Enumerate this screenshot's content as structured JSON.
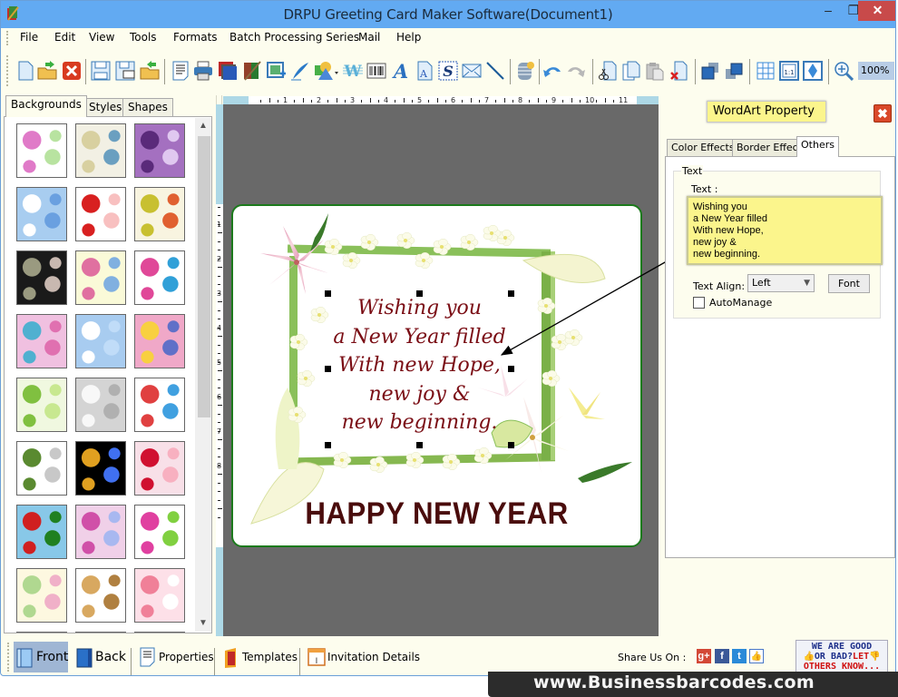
{
  "window": {
    "title": "DRPU Greeting Card Maker Software(Document1)",
    "minimize": "–",
    "maximize": "❐",
    "close": "✕"
  },
  "menu": [
    "File",
    "Edit",
    "View",
    "Tools",
    "Formats",
    "Batch Processing Series",
    "Mail",
    "Help"
  ],
  "toolbar": {
    "buttons": [
      "new",
      "open",
      "close-document",
      "save",
      "save-as",
      "export",
      "page-properties",
      "print",
      "print-preview",
      "background",
      "insert-image",
      "signature",
      "shapes",
      "watermark",
      "barcode",
      "wordart",
      "text",
      "signature-text",
      "email",
      "line",
      "database",
      "undo",
      "redo",
      "cut",
      "copy",
      "paste",
      "delete",
      "bring-to-front",
      "send-to-back",
      "grid",
      "actual-size",
      "fit-to-window",
      "zoom-in"
    ],
    "zoom_level": "100%"
  },
  "left_panel": {
    "tabs": [
      "Backgrounds",
      "Styles",
      "Shapes"
    ],
    "active_tab": "Backgrounds",
    "thumbnails": [
      {
        "name": "baby-pink-items",
        "colors": [
          "#fff",
          "#e07ac8",
          "#b8e3a0"
        ]
      },
      {
        "name": "baby-items-cream",
        "colors": [
          "#f2f0e4",
          "#d8d0a0",
          "#6a9fc0"
        ]
      },
      {
        "name": "purple-flowers",
        "colors": [
          "#a470c0",
          "#5a2a7a",
          "#e0c8f0"
        ]
      },
      {
        "name": "clouds-sky",
        "colors": [
          "#a8cdf0",
          "#ffffff",
          "#6aa0e0"
        ]
      },
      {
        "name": "strawberries",
        "colors": [
          "#ffffff",
          "#d82020",
          "#f8c0c0"
        ]
      },
      {
        "name": "autumn-leaves",
        "colors": [
          "#f8f4e0",
          "#c8c030",
          "#e06030"
        ]
      },
      {
        "name": "dark-leaves",
        "colors": [
          "#1a1a1a",
          "#9a9a80",
          "#c8b8b0"
        ]
      },
      {
        "name": "hearts-rows",
        "colors": [
          "#fafad8",
          "#e070a0",
          "#80b0e0"
        ]
      },
      {
        "name": "gift-boxes",
        "colors": [
          "#ffffff",
          "#e04898",
          "#30a0d8"
        ]
      },
      {
        "name": "flower-circles",
        "colors": [
          "#f0c0e0",
          "#50b0d0",
          "#e070b0"
        ]
      },
      {
        "name": "snowflakes",
        "colors": [
          "#a8ccf0",
          "#ffffff",
          "#c0dcf8"
        ]
      },
      {
        "name": "mandala-circles",
        "colors": [
          "#f0a8c8",
          "#f8d040",
          "#6070c8"
        ]
      },
      {
        "name": "christmas-trees",
        "colors": [
          "#f0f8e0",
          "#80c040",
          "#c8e890"
        ]
      },
      {
        "name": "white-heart",
        "colors": [
          "#d4d4d4",
          "#f8f8f8",
          "#b0b0b0"
        ]
      },
      {
        "name": "kids-doodle",
        "colors": [
          "#ffffff",
          "#e04040",
          "#40a0e0"
        ]
      },
      {
        "name": "green-hearts",
        "colors": [
          "#ffffff",
          "#5a8a30",
          "#c8c8c8"
        ]
      },
      {
        "name": "fireworks",
        "colors": [
          "#000000",
          "#e0a020",
          "#4070f0"
        ]
      },
      {
        "name": "red-hearts",
        "colors": [
          "#f8e0e8",
          "#d01030",
          "#f8b0c0"
        ]
      },
      {
        "name": "santa-pattern",
        "colors": [
          "#88c8e8",
          "#d02020",
          "#208020"
        ]
      },
      {
        "name": "pink-bokeh",
        "colors": [
          "#f0d0e8",
          "#d050a8",
          "#a8b8f0"
        ]
      },
      {
        "name": "pink-pinwheels",
        "colors": [
          "#ffffff",
          "#e040a0",
          "#80d040"
        ]
      },
      {
        "name": "pastel-stripes",
        "colors": [
          "#fdf8e0",
          "#b0d890",
          "#f0b0c8"
        ]
      },
      {
        "name": "teddy-bear",
        "colors": [
          "#ffffff",
          "#d8a860",
          "#b08040"
        ]
      },
      {
        "name": "pink-dress",
        "colors": [
          "#fde0e8",
          "#f08098",
          "#ffffff"
        ]
      },
      {
        "name": "pattern-25",
        "colors": [
          "#f8e0f0",
          "#e070a0",
          "#ffffff"
        ]
      },
      {
        "name": "pattern-26",
        "colors": [
          "#f06090",
          "#e04070",
          "#f8a0b8"
        ]
      },
      {
        "name": "pattern-27",
        "colors": [
          "#ffffff",
          "#a0c8e0",
          "#e0e0e0"
        ]
      }
    ]
  },
  "ruler": {
    "horizontal": [
      "1",
      "2",
      "3",
      "4",
      "5",
      "6",
      "7",
      "8",
      "9",
      "10",
      "11"
    ],
    "vertical": [
      "1",
      "2",
      "3",
      "4",
      "5",
      "6",
      "7",
      "8"
    ]
  },
  "card": {
    "wordart_lines": [
      "Wishing you",
      "a New Year filled",
      "With new Hope,",
      "new joy &",
      "new beginning."
    ],
    "headline": "HAPPY NEW YEAR",
    "text_color": "#7a0d14",
    "headline_color": "#4a0c0c",
    "border_color": "#1c7a1c"
  },
  "right_panel": {
    "title": "WordArt Property",
    "close": "✖",
    "tabs": [
      "Color Effects",
      "Border Effect",
      "Others"
    ],
    "active_tab": "Others",
    "group_label": "Text",
    "text_label": "Text :",
    "text_value": "Wishing you\na New Year filled\nWith new Hope,\nnew joy &\nnew beginning.",
    "align_label": "Text Align:",
    "align_value": "Left",
    "font_button": "Font",
    "automanage_label": "AutoManage",
    "automanage_checked": false
  },
  "bottom_bar": {
    "front": "Front",
    "back": "Back",
    "properties": "Properties",
    "templates": "Templates",
    "invitation": "Invitation Details",
    "share_label": "Share Us On :",
    "social": [
      {
        "name": "google-plus",
        "glyph": "g+",
        "color": "#d34836"
      },
      {
        "name": "facebook",
        "glyph": "f",
        "color": "#3b5998"
      },
      {
        "name": "twitter",
        "glyph": "t",
        "color": "#2a8ad8"
      },
      {
        "name": "like",
        "glyph": "👍",
        "color": "#4a78c8"
      }
    ],
    "feedback_line1": "WE ARE GOOD",
    "feedback_line2a": "OR BAD?",
    "feedback_line2b": "LET",
    "feedback_line3": "OTHERS KNOW..."
  },
  "footer": {
    "url": "www.Businessbarcodes.com"
  }
}
